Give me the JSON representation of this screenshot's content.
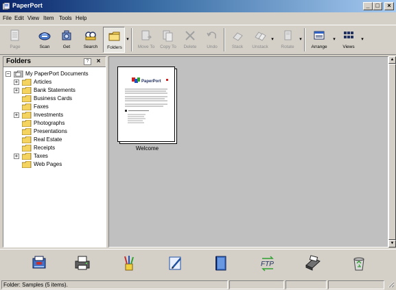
{
  "window": {
    "title": "PaperPort",
    "minimize": "_",
    "maximize": "□",
    "close": "×"
  },
  "menu": [
    "File",
    "Edit",
    "View",
    "Item",
    "Tools",
    "Help"
  ],
  "toolbar": {
    "buttons": [
      {
        "label": "Page",
        "icon": "page-icon",
        "enabled": false
      },
      {
        "label": "Scan",
        "icon": "scan-icon",
        "enabled": true
      },
      {
        "label": "Get",
        "icon": "get-icon",
        "enabled": true
      },
      {
        "label": "Search",
        "icon": "search-icon",
        "enabled": true
      },
      {
        "label": "Folders",
        "icon": "folders-icon",
        "enabled": true,
        "pressed": true
      },
      {
        "label": "Move To",
        "icon": "move-to-icon",
        "enabled": false
      },
      {
        "label": "Copy To",
        "icon": "copy-to-icon",
        "enabled": false
      },
      {
        "label": "Delete",
        "icon": "delete-icon",
        "enabled": false
      },
      {
        "label": "Undo",
        "icon": "undo-icon",
        "enabled": false
      },
      {
        "label": "Stack",
        "icon": "stack-icon",
        "enabled": false
      },
      {
        "label": "Unstack",
        "icon": "unstack-icon",
        "enabled": false
      },
      {
        "label": "Rotate",
        "icon": "rotate-icon",
        "enabled": false
      },
      {
        "label": "Arrange",
        "icon": "arrange-icon",
        "enabled": true
      },
      {
        "label": "Views",
        "icon": "views-icon",
        "enabled": true
      }
    ]
  },
  "folders": {
    "title": "Folders",
    "help": "?",
    "close": "×",
    "root": "My PaperPort Documents",
    "items": [
      {
        "label": "Articles",
        "expandable": true
      },
      {
        "label": "Bank Statements",
        "expandable": true
      },
      {
        "label": "Business Cards",
        "expandable": false
      },
      {
        "label": "Faxes",
        "expandable": false
      },
      {
        "label": "Investments",
        "expandable": true
      },
      {
        "label": "Photographs",
        "expandable": false
      },
      {
        "label": "Presentations",
        "expandable": false
      },
      {
        "label": "Real Estate",
        "expandable": false
      },
      {
        "label": "Receipts",
        "expandable": false
      },
      {
        "label": "Taxes",
        "expandable": true
      },
      {
        "label": "Web Pages",
        "expandable": false
      }
    ]
  },
  "main": {
    "items": [
      {
        "label": "Welcome",
        "logo_text": "PaperPort"
      }
    ]
  },
  "sendbar": {
    "icons": [
      "fax-icon",
      "printer-icon",
      "paint-icon",
      "editor-icon",
      "book-icon",
      "ftp-icon",
      "scanner-icon",
      "recycle-icon"
    ],
    "ftp_text": "FTP"
  },
  "status": {
    "text": "Folder: Samples (5 items)."
  },
  "colors": {
    "title_start": "#0a246a",
    "title_end": "#a6caf0",
    "folder_yellow": "#f4d35e",
    "chrome": "#d4d0c8"
  }
}
